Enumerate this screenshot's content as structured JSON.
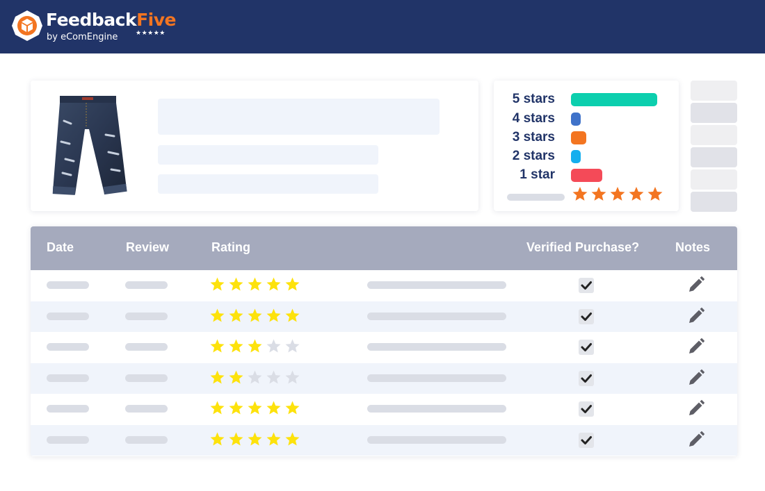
{
  "brand": {
    "name_white": "Feedback",
    "name_orange": "Five",
    "tagline": "by eComEngine",
    "tagline_stars": "★★★★★",
    "colors": {
      "header": "#213468",
      "accent": "#f37521"
    }
  },
  "product": {
    "image": "jeans-shorts-image"
  },
  "rating_distribution": {
    "rows": [
      {
        "label": "5 stars",
        "fraction": 1.0,
        "color": "#0ccfae"
      },
      {
        "label": "4 stars",
        "fraction": 0.11,
        "color": "#3f72c9"
      },
      {
        "label": "3 stars",
        "fraction": 0.18,
        "color": "#f37521"
      },
      {
        "label": "2 stars",
        "fraction": 0.11,
        "color": "#14aeee"
      },
      {
        "label": "1 star",
        "fraction": 0.36,
        "color": "#f44a58"
      }
    ],
    "average_stars": 5,
    "average_star_color": "#f37521"
  },
  "reviews_table": {
    "columns": [
      "Date",
      "Review",
      "Rating",
      "Verified Purchase?",
      "Notes"
    ],
    "rows": [
      {
        "rating": 5,
        "verified": true,
        "notes_icon": "pencil-icon"
      },
      {
        "rating": 5,
        "verified": true,
        "notes_icon": "pencil-icon"
      },
      {
        "rating": 3,
        "verified": true,
        "notes_icon": "pencil-icon"
      },
      {
        "rating": 2,
        "verified": true,
        "notes_icon": "pencil-icon"
      },
      {
        "rating": 5,
        "verified": true,
        "notes_icon": "pencil-icon"
      },
      {
        "rating": 5,
        "verified": true,
        "notes_icon": "pencil-icon"
      }
    ],
    "filled_star_color": "#fde20c",
    "empty_star_color": "#dadde5"
  }
}
